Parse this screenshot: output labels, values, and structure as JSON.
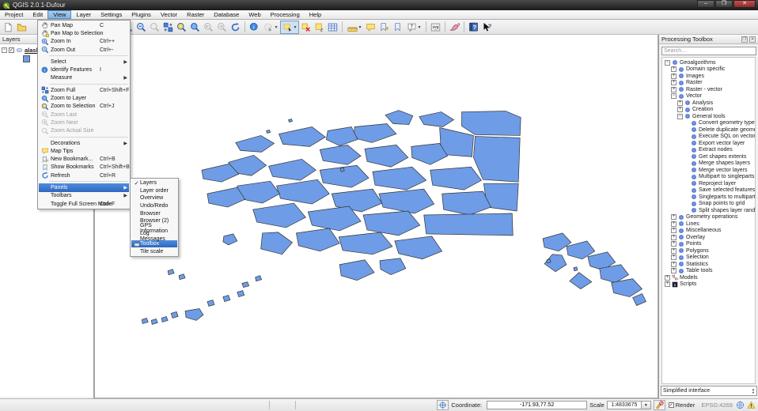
{
  "window": {
    "title": "QGIS 2.0.1-Dufour",
    "minimize": "–",
    "maximize": "❐",
    "close": "✕"
  },
  "menu_bar": {
    "active": "View",
    "items": [
      "Project",
      "Edit",
      "View",
      "Layer",
      "Settings",
      "Plugins",
      "Vector",
      "Raster",
      "Database",
      "Web",
      "Processing",
      "Help"
    ]
  },
  "toolbar": {
    "items": [
      {
        "icon": "new-project"
      },
      {
        "icon": "open-project"
      },
      {
        "spacer": true
      },
      {
        "icon": "pan-selection"
      },
      {
        "icon": "zoom-in"
      },
      {
        "icon": "zoom-out"
      },
      {
        "icon": "zoom-native",
        "grey": true
      },
      {
        "icon": "zoom-full"
      },
      {
        "icon": "zoom-selection"
      },
      {
        "icon": "zoom-layer"
      },
      {
        "icon": "zoom-last",
        "grey": true
      },
      {
        "icon": "zoom-next",
        "grey": true
      },
      {
        "icon": "refresh"
      },
      {
        "sep": true
      },
      {
        "icon": "identify"
      },
      {
        "icon": "select-rubber",
        "grey": true,
        "caret": true
      },
      {
        "icon": "select-rect",
        "pressed": true,
        "caret": true
      },
      {
        "icon": "deselect-all"
      },
      {
        "icon": "select-expression"
      },
      {
        "icon": "attribute-table"
      },
      {
        "sep": true
      },
      {
        "icon": "measure",
        "caret": true
      },
      {
        "icon": "map-tips"
      },
      {
        "icon": "new-bookmark"
      },
      {
        "icon": "show-bookmarks"
      },
      {
        "icon": "text-annotation",
        "caret": true
      },
      {
        "sep": true
      },
      {
        "icon": "svg-annotation"
      },
      {
        "sep": true
      },
      {
        "icon": "style"
      },
      {
        "sep": true
      },
      {
        "icon": "help-contents"
      },
      {
        "icon": "whats-this"
      }
    ]
  },
  "view_menu": {
    "items": [
      {
        "label": "Pan Map",
        "shortcut": "C",
        "icon": "pan"
      },
      {
        "label": "Pan Map to Selection",
        "icon": "pan-selection"
      },
      {
        "label": "Zoom In",
        "shortcut": "Ctrl++",
        "icon": "zoom-in"
      },
      {
        "label": "Zoom Out",
        "shortcut": "Ctrl+-",
        "icon": "zoom-out"
      },
      {
        "separator": true
      },
      {
        "label": "Select",
        "submenu": true
      },
      {
        "label": "Identify Features",
        "shortcut": "I",
        "icon": "identify"
      },
      {
        "label": "Measure",
        "submenu": true
      },
      {
        "separator": true
      },
      {
        "label": "Zoom Full",
        "shortcut": "Ctrl+Shift+F",
        "icon": "zoom-full"
      },
      {
        "label": "Zoom to Layer",
        "icon": "zoom-layer"
      },
      {
        "label": "Zoom to Selection",
        "shortcut": "Ctrl+J",
        "icon": "zoom-selection"
      },
      {
        "label": "Zoom Last",
        "icon": "zoom-last",
        "disabled": true
      },
      {
        "label": "Zoom Next",
        "icon": "zoom-next",
        "disabled": true
      },
      {
        "label": "Zoom Actual Size",
        "icon": "zoom-native",
        "disabled": true
      },
      {
        "separator": true
      },
      {
        "label": "Decorations",
        "submenu": true
      },
      {
        "label": "Map Tips",
        "icon": "map-tips"
      },
      {
        "label": "New Bookmark...",
        "shortcut": "Ctrl+B",
        "icon": "new-bookmark"
      },
      {
        "label": "Show Bookmarks",
        "shortcut": "Ctrl+Shift+B",
        "icon": "show-bookmarks"
      },
      {
        "label": "Refresh",
        "shortcut": "Ctrl+R",
        "icon": "refresh"
      },
      {
        "separator": true
      },
      {
        "label": "Panels",
        "submenu": true,
        "highlighted": true
      },
      {
        "label": "Toolbars",
        "submenu": true
      },
      {
        "label": "Toggle Full Screen Mode",
        "shortcut": "Ctrl+F"
      }
    ]
  },
  "panels_submenu": {
    "items": [
      {
        "label": "Layers",
        "checked": true
      },
      {
        "label": "Layer order"
      },
      {
        "label": "Overview"
      },
      {
        "label": "Undo/Redo"
      },
      {
        "label": "Browser"
      },
      {
        "label": "Browser (2)"
      },
      {
        "label": "GPS Information"
      },
      {
        "label": "Log Messages"
      },
      {
        "label": "Toolbox",
        "highlighted": true,
        "icon": "toolbox"
      },
      {
        "label": "Tile scale"
      }
    ]
  },
  "layers_panel": {
    "title": "Layers",
    "layer_name": "alaska",
    "checked": true
  },
  "processing_panel": {
    "title": "Processing Toolbox",
    "search_placeholder": "Search...",
    "footer_value": "Simplified interface",
    "tree": [
      {
        "label": "Geoalgorithms",
        "level": 0,
        "group": true,
        "expanded": true
      },
      {
        "label": "Domain specific",
        "level": 1,
        "group": true
      },
      {
        "label": "Images",
        "level": 1,
        "group": true
      },
      {
        "label": "Raster",
        "level": 1,
        "group": true
      },
      {
        "label": "Raster - vector",
        "level": 1,
        "group": true
      },
      {
        "label": "Vector",
        "level": 1,
        "group": true,
        "expanded": true
      },
      {
        "label": "Analysis",
        "level": 2,
        "group": true
      },
      {
        "label": "Creation",
        "level": 2,
        "group": true
      },
      {
        "label": "General tools",
        "level": 2,
        "group": true,
        "expanded": true
      },
      {
        "label": "Convert geometry type",
        "level": 3
      },
      {
        "label": "Delete duplicate geometries",
        "level": 3
      },
      {
        "label": "Execute SQL on vector layer",
        "level": 3
      },
      {
        "label": "Export vector layer",
        "level": 3
      },
      {
        "label": "Extract nodes",
        "level": 3
      },
      {
        "label": "Get shapes extents",
        "level": 3
      },
      {
        "label": "Merge shapes layers",
        "level": 3
      },
      {
        "label": "Merge vector layers",
        "level": 3
      },
      {
        "label": "Multipart to singleparts",
        "level": 3
      },
      {
        "label": "Reproject layer",
        "level": 3
      },
      {
        "label": "Save selected features",
        "level": 3
      },
      {
        "label": "Singleparts to multipart",
        "level": 3
      },
      {
        "label": "Snap points to grid",
        "level": 3
      },
      {
        "label": "Split shapes layer randomly",
        "level": 3
      },
      {
        "label": "Geometry operations",
        "level": 1,
        "group": true
      },
      {
        "label": "Lines",
        "level": 1,
        "group": true
      },
      {
        "label": "Miscellaneous",
        "level": 1,
        "group": true
      },
      {
        "label": "Overlay",
        "level": 1,
        "group": true
      },
      {
        "label": "Points",
        "level": 1,
        "group": true
      },
      {
        "label": "Polygons",
        "level": 1,
        "group": true
      },
      {
        "label": "Selection",
        "level": 1,
        "group": true
      },
      {
        "label": "Statistics",
        "level": 1,
        "group": true
      },
      {
        "label": "Table tools",
        "level": 1,
        "group": true
      },
      {
        "label": "Models",
        "level": 0,
        "group": true,
        "icon": "model"
      },
      {
        "label": "Scripts",
        "level": 0,
        "group": true,
        "icon": "script"
      }
    ]
  },
  "status_bar": {
    "coordinate_label": "Coordinate:",
    "coordinate_value": "-171.93,77.52",
    "scale_label": "Scale",
    "scale_value": "1:4833675",
    "render_label": "Render",
    "render_checked": true,
    "epsg": "EPSG:4269"
  },
  "map": {
    "fill": "#6f9ce6",
    "stroke": "#333333",
    "polygons": [
      "487,146 504,140 522,147 517,158 497,157",
      "530,148 558,142 574,152 560,161 536,158",
      "584,142 640,141 659,149 658,172 601,171 584,160",
      "556,162 599,172 597,199 558,196",
      "601,173 658,175 656,231 611,228 599,200",
      "448,161 489,157 501,170 470,181 447,175",
      "414,166 444,161 452,177 429,185 412,177",
      "352,170 394,161 411,174 391,186 357,183",
      "297,181 329,172 346,182 330,193 303,191",
      "404,190 439,184 456,198 439,209 408,204",
      "461,189 501,184 516,200 494,212 464,205",
      "520,186 556,182 566,198 544,209 521,200",
      "288,206 320,197 336,210 317,223 293,219",
      "254,216 289,208 301,221 279,231 256,227",
      "339,211 381,202 399,216 379,229 344,224",
      "404,216 451,210 466,226 444,238 408,232",
      "471,218 521,212 539,229 514,241 474,235",
      "544,216 596,212 609,229 587,241 547,235",
      "612,233 656,233 654,268 616,263",
      "559,246 611,243 621,263 594,273 561,266",
      "479,246 536,240 549,259 524,271 484,263",
      "419,246 471,240 483,258 457,269 424,262",
      "349,236 401,228 416,246 394,259 354,252",
      "299,236 341,230 353,246 331,258 301,252",
      "261,246 299,238 309,253 287,263 263,258",
      "319,266 371,258 386,276 361,289 324,282",
      "389,269 441,262 456,281 429,293 394,286",
      "459,273 516,268 531,286 504,299 464,292",
      "536,273 648,271 649,299 539,297",
      "428,301 481,295 496,313 471,323 433,318",
      "499,306 546,300 559,319 534,329 504,322",
      "374,296 416,290 429,309 404,319 377,312",
      "331,296 329,316 356,323 369,308 351,295",
      "282,300 294,297 299,306 288,311 281,307",
      "429,336 461,330 473,346 451,356 431,350",
      "480,331 506,328 513,341 494,349 481,342",
      "687,303 712,296 723,308 707,319 689,314",
      "717,313 743,306 753,319 737,329 719,324",
      "699,323 689,335 703,345 717,336 711,324",
      "744,326 769,320 779,333 763,343 747,338",
      "759,341 786,336 796,349 779,359 761,354",
      "733,346 721,357 735,367 749,358",
      "774,359 801,354 813,367 797,377 777,372",
      "801,378 813,373 818,383 806,388",
      "692,330 696,329 697,333 693,334",
      "726,340 730,339 731,343 727,344",
      "299,371 306,369 308,375 301,377",
      "281,377 288,375 290,381 283,383",
      "261,383 268,381 270,387 263,389",
      "233,395 251,392 256,400 247,407 234,403",
      "215,398 222,396 224,402 217,404",
      "203,404 209,402 211,407 204,409",
      "190,407 196,405 198,410 191,412",
      "178,406 184,404 186,409 179,411",
      "211,344 217,342 219,347 212,349",
      "225,350 231,348 233,353 226,355",
      "305,360 312,358 314,363 307,365",
      "322,352 328,350 330,355 323,357",
      "430,214 434,213 435,217 431,218",
      "364,152 368,151 369,154 365,155",
      "336,166 340,165 341,168 337,169"
    ]
  }
}
